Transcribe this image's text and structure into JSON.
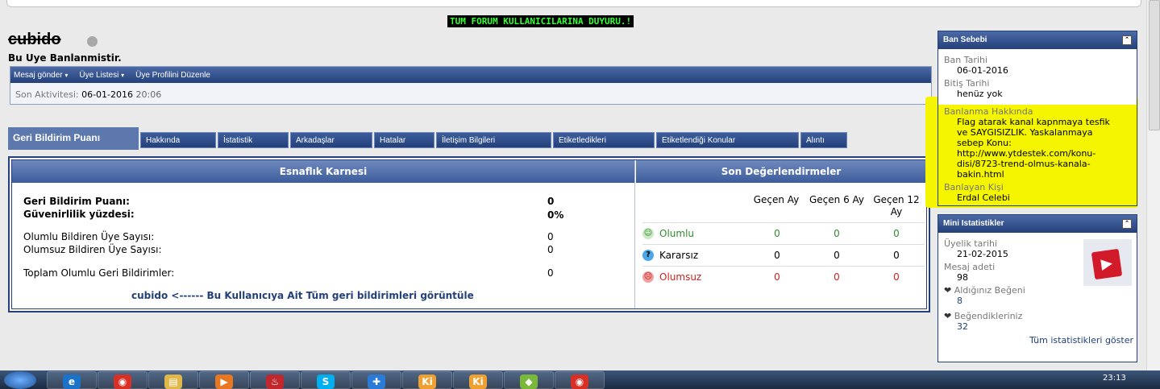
{
  "announcement": "TUM FORUM KULLANICILARINA DUYURU.!",
  "profile": {
    "username": "cubido",
    "banned_text": "Bu Uye Banlanmistir.",
    "nav": [
      {
        "label": "Mesaj gönder",
        "caret": "▾"
      },
      {
        "label": "Üye Listesi",
        "caret": "▾"
      },
      {
        "label": "Üye Profilini Düzenle",
        "caret": ""
      }
    ],
    "activity_label": "Son Aktivitesi:",
    "activity_date": "06-01-2016",
    "activity_time": "20:06"
  },
  "tabs": [
    "Geri Bildirim Puanı",
    "Hakkında",
    "İstatistik",
    "Arkadaşlar",
    "Hatalar",
    "İletişim Bilgileri",
    "Etiketledikleri",
    "Etiketlendiği Konular",
    "Alıntı"
  ],
  "feedback": {
    "left_title": "Esnaflık Karnesi",
    "right_title": "Son Değerlendirmeler",
    "rows": [
      {
        "label": "Geri Bildirim Puanı:",
        "value": "0"
      },
      {
        "label": "Güvenirlilik yüzdesi:",
        "value": "0%"
      },
      {
        "label": "Olumlu Bildiren Üye Sayısı:",
        "value": "0"
      },
      {
        "label": "Olumsuz Bildiren Üye Sayısı:",
        "value": "0"
      },
      {
        "label": "Toplam Olumlu Geri Bildirimler:",
        "value": "0"
      }
    ],
    "link_user": "cubido",
    "link_text": "<------ Bu Kullanıcıya Ait Tüm geri bildirimleri görüntüle",
    "columns": [
      "Geçen Ay",
      "Geçen 6 Ay",
      "Geçen 12 Ay"
    ],
    "ratings": [
      {
        "label": "Olumlu",
        "values": [
          "0",
          "0",
          "0"
        ],
        "color": "#2e8b2e",
        "icon": "☺"
      },
      {
        "label": "Kararsız",
        "values": [
          "0",
          "0",
          "0"
        ],
        "color": "#000000",
        "icon": "?"
      },
      {
        "label": "Olumsuz",
        "values": [
          "0",
          "0",
          "0"
        ],
        "color": "#d12020",
        "icon": "☹"
      }
    ]
  },
  "ban_panel": {
    "title": "Ban Sebebi",
    "date_label": "Ban Tarihi",
    "date_value": "06-01-2016",
    "end_label": "Bitiş Tarihi",
    "end_value": "henüz yok",
    "reason_label": "Banlanma Hakkında",
    "reason_value": "Flag atarak kanal kapnmaya tesfik ve SAYGISIZLIK. Yaskalanmaya sebep Konu: http://www.ytdestek.com/konu-disi/8723-trend-olmus-kanala-bakin.html",
    "by_label": "Banlayan Kişi",
    "by_value": "Erdal Celebi",
    "highlight_color": "#f5f500"
  },
  "mini_stats": {
    "title": "Mini Istatistikler",
    "join_label": "Üyelik tarihi",
    "join_value": "21-02-2015",
    "posts_label": "Mesaj adeti",
    "posts_value": "98",
    "likes_recv_label": "Aldığınız Beğeni",
    "likes_recv_value": "8",
    "likes_given_label": "Beğendikleriniz",
    "likes_given_value": "32",
    "all_stats_link": "Tüm istatistikleri göster"
  },
  "taskbar": {
    "clock": "23:13",
    "apps": [
      {
        "name": "ie-icon",
        "glyph": "e",
        "color": "#1a73c9"
      },
      {
        "name": "chrome-icon",
        "glyph": "◉",
        "color": "#d93025"
      },
      {
        "name": "folder-icon",
        "glyph": "▤",
        "color": "#e0b84a"
      },
      {
        "name": "media-icon",
        "glyph": "▶",
        "color": "#e87722"
      },
      {
        "name": "app-red-icon",
        "glyph": "♨",
        "color": "#c0282d"
      },
      {
        "name": "skype-icon",
        "glyph": "S",
        "color": "#00aff0"
      },
      {
        "name": "firstaid-icon",
        "glyph": "✚",
        "color": "#2a7bd8"
      },
      {
        "name": "kodi-icon-1",
        "glyph": "Ki",
        "color": "#f0a030"
      },
      {
        "name": "kodi-icon-2",
        "glyph": "Ki",
        "color": "#f0a030"
      },
      {
        "name": "image-icon",
        "glyph": "◆",
        "color": "#7ab83a"
      },
      {
        "name": "chrome-icon-2",
        "glyph": "◉",
        "color": "#d93025"
      }
    ]
  }
}
